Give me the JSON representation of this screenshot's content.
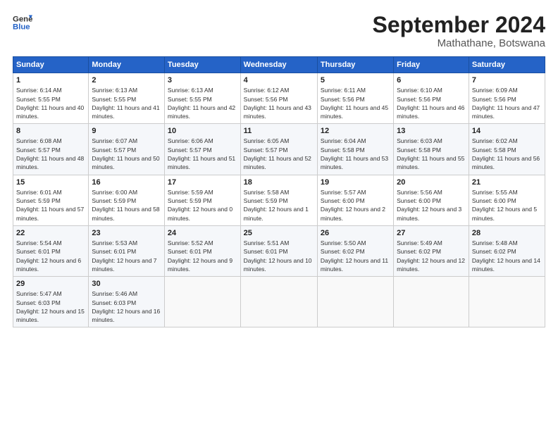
{
  "header": {
    "logo_line1": "General",
    "logo_line2": "Blue",
    "month": "September 2024",
    "location": "Mathathane, Botswana"
  },
  "days_of_week": [
    "Sunday",
    "Monday",
    "Tuesday",
    "Wednesday",
    "Thursday",
    "Friday",
    "Saturday"
  ],
  "weeks": [
    [
      {
        "num": "1",
        "sunrise": "Sunrise: 6:14 AM",
        "sunset": "Sunset: 5:55 PM",
        "daylight": "Daylight: 11 hours and 40 minutes."
      },
      {
        "num": "2",
        "sunrise": "Sunrise: 6:13 AM",
        "sunset": "Sunset: 5:55 PM",
        "daylight": "Daylight: 11 hours and 41 minutes."
      },
      {
        "num": "3",
        "sunrise": "Sunrise: 6:13 AM",
        "sunset": "Sunset: 5:55 PM",
        "daylight": "Daylight: 11 hours and 42 minutes."
      },
      {
        "num": "4",
        "sunrise": "Sunrise: 6:12 AM",
        "sunset": "Sunset: 5:56 PM",
        "daylight": "Daylight: 11 hours and 43 minutes."
      },
      {
        "num": "5",
        "sunrise": "Sunrise: 6:11 AM",
        "sunset": "Sunset: 5:56 PM",
        "daylight": "Daylight: 11 hours and 45 minutes."
      },
      {
        "num": "6",
        "sunrise": "Sunrise: 6:10 AM",
        "sunset": "Sunset: 5:56 PM",
        "daylight": "Daylight: 11 hours and 46 minutes."
      },
      {
        "num": "7",
        "sunrise": "Sunrise: 6:09 AM",
        "sunset": "Sunset: 5:56 PM",
        "daylight": "Daylight: 11 hours and 47 minutes."
      }
    ],
    [
      {
        "num": "8",
        "sunrise": "Sunrise: 6:08 AM",
        "sunset": "Sunset: 5:57 PM",
        "daylight": "Daylight: 11 hours and 48 minutes."
      },
      {
        "num": "9",
        "sunrise": "Sunrise: 6:07 AM",
        "sunset": "Sunset: 5:57 PM",
        "daylight": "Daylight: 11 hours and 50 minutes."
      },
      {
        "num": "10",
        "sunrise": "Sunrise: 6:06 AM",
        "sunset": "Sunset: 5:57 PM",
        "daylight": "Daylight: 11 hours and 51 minutes."
      },
      {
        "num": "11",
        "sunrise": "Sunrise: 6:05 AM",
        "sunset": "Sunset: 5:57 PM",
        "daylight": "Daylight: 11 hours and 52 minutes."
      },
      {
        "num": "12",
        "sunrise": "Sunrise: 6:04 AM",
        "sunset": "Sunset: 5:58 PM",
        "daylight": "Daylight: 11 hours and 53 minutes."
      },
      {
        "num": "13",
        "sunrise": "Sunrise: 6:03 AM",
        "sunset": "Sunset: 5:58 PM",
        "daylight": "Daylight: 11 hours and 55 minutes."
      },
      {
        "num": "14",
        "sunrise": "Sunrise: 6:02 AM",
        "sunset": "Sunset: 5:58 PM",
        "daylight": "Daylight: 11 hours and 56 minutes."
      }
    ],
    [
      {
        "num": "15",
        "sunrise": "Sunrise: 6:01 AM",
        "sunset": "Sunset: 5:59 PM",
        "daylight": "Daylight: 11 hours and 57 minutes."
      },
      {
        "num": "16",
        "sunrise": "Sunrise: 6:00 AM",
        "sunset": "Sunset: 5:59 PM",
        "daylight": "Daylight: 11 hours and 58 minutes."
      },
      {
        "num": "17",
        "sunrise": "Sunrise: 5:59 AM",
        "sunset": "Sunset: 5:59 PM",
        "daylight": "Daylight: 12 hours and 0 minutes."
      },
      {
        "num": "18",
        "sunrise": "Sunrise: 5:58 AM",
        "sunset": "Sunset: 5:59 PM",
        "daylight": "Daylight: 12 hours and 1 minute."
      },
      {
        "num": "19",
        "sunrise": "Sunrise: 5:57 AM",
        "sunset": "Sunset: 6:00 PM",
        "daylight": "Daylight: 12 hours and 2 minutes."
      },
      {
        "num": "20",
        "sunrise": "Sunrise: 5:56 AM",
        "sunset": "Sunset: 6:00 PM",
        "daylight": "Daylight: 12 hours and 3 minutes."
      },
      {
        "num": "21",
        "sunrise": "Sunrise: 5:55 AM",
        "sunset": "Sunset: 6:00 PM",
        "daylight": "Daylight: 12 hours and 5 minutes."
      }
    ],
    [
      {
        "num": "22",
        "sunrise": "Sunrise: 5:54 AM",
        "sunset": "Sunset: 6:01 PM",
        "daylight": "Daylight: 12 hours and 6 minutes."
      },
      {
        "num": "23",
        "sunrise": "Sunrise: 5:53 AM",
        "sunset": "Sunset: 6:01 PM",
        "daylight": "Daylight: 12 hours and 7 minutes."
      },
      {
        "num": "24",
        "sunrise": "Sunrise: 5:52 AM",
        "sunset": "Sunset: 6:01 PM",
        "daylight": "Daylight: 12 hours and 9 minutes."
      },
      {
        "num": "25",
        "sunrise": "Sunrise: 5:51 AM",
        "sunset": "Sunset: 6:01 PM",
        "daylight": "Daylight: 12 hours and 10 minutes."
      },
      {
        "num": "26",
        "sunrise": "Sunrise: 5:50 AM",
        "sunset": "Sunset: 6:02 PM",
        "daylight": "Daylight: 12 hours and 11 minutes."
      },
      {
        "num": "27",
        "sunrise": "Sunrise: 5:49 AM",
        "sunset": "Sunset: 6:02 PM",
        "daylight": "Daylight: 12 hours and 12 minutes."
      },
      {
        "num": "28",
        "sunrise": "Sunrise: 5:48 AM",
        "sunset": "Sunset: 6:02 PM",
        "daylight": "Daylight: 12 hours and 14 minutes."
      }
    ],
    [
      {
        "num": "29",
        "sunrise": "Sunrise: 5:47 AM",
        "sunset": "Sunset: 6:03 PM",
        "daylight": "Daylight: 12 hours and 15 minutes."
      },
      {
        "num": "30",
        "sunrise": "Sunrise: 5:46 AM",
        "sunset": "Sunset: 6:03 PM",
        "daylight": "Daylight: 12 hours and 16 minutes."
      },
      null,
      null,
      null,
      null,
      null
    ]
  ]
}
